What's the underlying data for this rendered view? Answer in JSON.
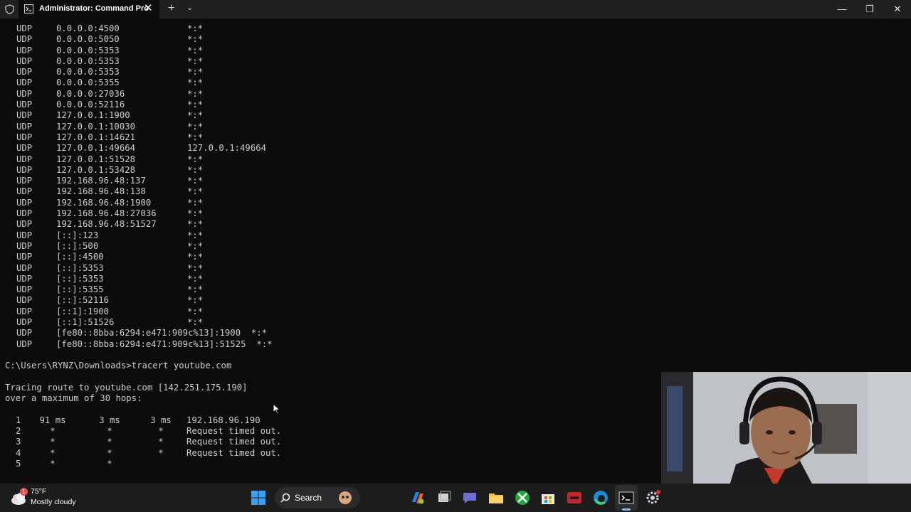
{
  "window": {
    "tab_title": "Administrator: Command Pro",
    "close_tab_glyph": "✕",
    "new_tab_glyph": "+",
    "dropdown_glyph": "⌄",
    "minimize_glyph": "—",
    "maximize_glyph": "❐",
    "close_glyph": "✕"
  },
  "netstat_rows": [
    {
      "proto": "UDP",
      "local": "0.0.0.0:4500",
      "foreign": "*:*"
    },
    {
      "proto": "UDP",
      "local": "0.0.0.0:5050",
      "foreign": "*:*"
    },
    {
      "proto": "UDP",
      "local": "0.0.0.0:5353",
      "foreign": "*:*"
    },
    {
      "proto": "UDP",
      "local": "0.0.0.0:5353",
      "foreign": "*:*"
    },
    {
      "proto": "UDP",
      "local": "0.0.0.0:5353",
      "foreign": "*:*"
    },
    {
      "proto": "UDP",
      "local": "0.0.0.0:5355",
      "foreign": "*:*"
    },
    {
      "proto": "UDP",
      "local": "0.0.0.0:27036",
      "foreign": "*:*"
    },
    {
      "proto": "UDP",
      "local": "0.0.0.0:52116",
      "foreign": "*:*"
    },
    {
      "proto": "UDP",
      "local": "127.0.0.1:1900",
      "foreign": "*:*"
    },
    {
      "proto": "UDP",
      "local": "127.0.0.1:10030",
      "foreign": "*:*"
    },
    {
      "proto": "UDP",
      "local": "127.0.0.1:14621",
      "foreign": "*:*"
    },
    {
      "proto": "UDP",
      "local": "127.0.0.1:49664",
      "foreign": "127.0.0.1:49664"
    },
    {
      "proto": "UDP",
      "local": "127.0.0.1:51528",
      "foreign": "*:*"
    },
    {
      "proto": "UDP",
      "local": "127.0.0.1:53428",
      "foreign": "*:*"
    },
    {
      "proto": "UDP",
      "local": "192.168.96.48:137",
      "foreign": "*:*"
    },
    {
      "proto": "UDP",
      "local": "192.168.96.48:138",
      "foreign": "*:*"
    },
    {
      "proto": "UDP",
      "local": "192.168.96.48:1900",
      "foreign": "*:*"
    },
    {
      "proto": "UDP",
      "local": "192.168.96.48:27036",
      "foreign": "*:*"
    },
    {
      "proto": "UDP",
      "local": "192.168.96.48:51527",
      "foreign": "*:*"
    },
    {
      "proto": "UDP",
      "local": "[::]:123",
      "foreign": "*:*"
    },
    {
      "proto": "UDP",
      "local": "[::]:500",
      "foreign": "*:*"
    },
    {
      "proto": "UDP",
      "local": "[::]:4500",
      "foreign": "*:*"
    },
    {
      "proto": "UDP",
      "local": "[::]:5353",
      "foreign": "*:*"
    },
    {
      "proto": "UDP",
      "local": "[::]:5353",
      "foreign": "*:*"
    },
    {
      "proto": "UDP",
      "local": "[::]:5355",
      "foreign": "*:*"
    },
    {
      "proto": "UDP",
      "local": "[::]:52116",
      "foreign": "*:*"
    },
    {
      "proto": "UDP",
      "local": "[::1]:1900",
      "foreign": "*:*"
    },
    {
      "proto": "UDP",
      "local": "[::1]:51526",
      "foreign": "*:*"
    }
  ],
  "ipv6_rows": [
    "[fe80::8bba:6294:e471:909c%13]:1900  *:*",
    "[fe80::8bba:6294:e471:909c%13]:51525  *:*"
  ],
  "command": "C:\\Users\\RYNZ\\Downloads>tracert youtube.com",
  "tracing_line": "Tracing route to youtube.com [142.251.175.190]",
  "hops_line": "over a maximum of 30 hops:",
  "hops": [
    {
      "n": "1",
      "a": "91 ms",
      "b": "3 ms",
      "c": "3 ms",
      "res": "192.168.96.190"
    },
    {
      "n": "2",
      "a": "*",
      "b": "*",
      "c": "*",
      "res": "Request timed out."
    },
    {
      "n": "3",
      "a": "*",
      "b": "*",
      "c": "*",
      "res": "Request timed out."
    },
    {
      "n": "4",
      "a": "*",
      "b": "*",
      "c": "*",
      "res": "Request timed out."
    },
    {
      "n": "5",
      "a": "*",
      "b": "*",
      "c": "",
      "res": ""
    }
  ],
  "taskbar": {
    "weather_temp": "75°F",
    "weather_desc": "Mostly cloudy",
    "weather_badge": "1",
    "search_label": "Search",
    "icons": [
      "windows-start-icon",
      "search-icon",
      "copilot-icon",
      "task-view-icon",
      "teams-chat-icon",
      "file-explorer-icon",
      "xbox-icon",
      "microsoft-store-icon",
      "game-launcher-icon",
      "edge-browser-icon",
      "terminal-icon",
      "settings-icon"
    ]
  }
}
